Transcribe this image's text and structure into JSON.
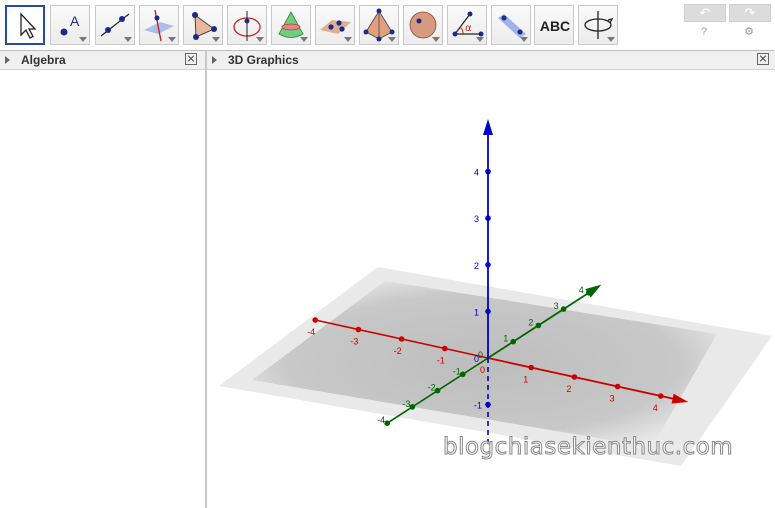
{
  "toolbar": {
    "tools": [
      {
        "name": "move-tool",
        "icon": "arrow-pointer-icon",
        "selected": true
      },
      {
        "name": "point-tool",
        "icon": "point-a-icon",
        "label": "A"
      },
      {
        "name": "line-tool",
        "icon": "line-through-two-points-icon"
      },
      {
        "name": "perpendicular-line-tool",
        "icon": "perpendicular-line-icon"
      },
      {
        "name": "polygon-tool",
        "icon": "triangle-icon"
      },
      {
        "name": "circle-tool",
        "icon": "circle-axis-icon"
      },
      {
        "name": "intersect-surfaces-tool",
        "icon": "cone-intersection-icon"
      },
      {
        "name": "plane-through-points-tool",
        "icon": "plane-points-icon"
      },
      {
        "name": "pyramid-tool",
        "icon": "pyramid-icon"
      },
      {
        "name": "sphere-tool",
        "icon": "sphere-icon"
      },
      {
        "name": "angle-tool",
        "icon": "angle-alpha-icon",
        "label": "α"
      },
      {
        "name": "reflect-tool",
        "icon": "reflect-plane-icon"
      },
      {
        "name": "text-tool",
        "icon": "text-abc-icon",
        "label": "ABC"
      },
      {
        "name": "rotate-view-tool",
        "icon": "rotate-view-icon"
      }
    ],
    "undo_label": "↶",
    "redo_label": "↷",
    "help_label": "?",
    "settings_label": "⚙"
  },
  "algebra_panel": {
    "title": "Algebra"
  },
  "graphics_panel": {
    "title": "3D Graphics"
  },
  "axes": {
    "x": {
      "color": "#cc0000",
      "ticks": [
        "-4",
        "-3",
        "-2",
        "-1",
        "0",
        "1",
        "2",
        "3",
        "4"
      ]
    },
    "y": {
      "color": "#006600",
      "ticks": [
        "-4",
        "-3",
        "-2",
        "-1",
        "0",
        "1",
        "2",
        "3",
        "4"
      ]
    },
    "z": {
      "color": "#0000cc",
      "ticks": [
        "-1",
        "0",
        "1",
        "2",
        "3",
        "4"
      ]
    }
  },
  "watermark": "blogchiasekienthuc.com"
}
